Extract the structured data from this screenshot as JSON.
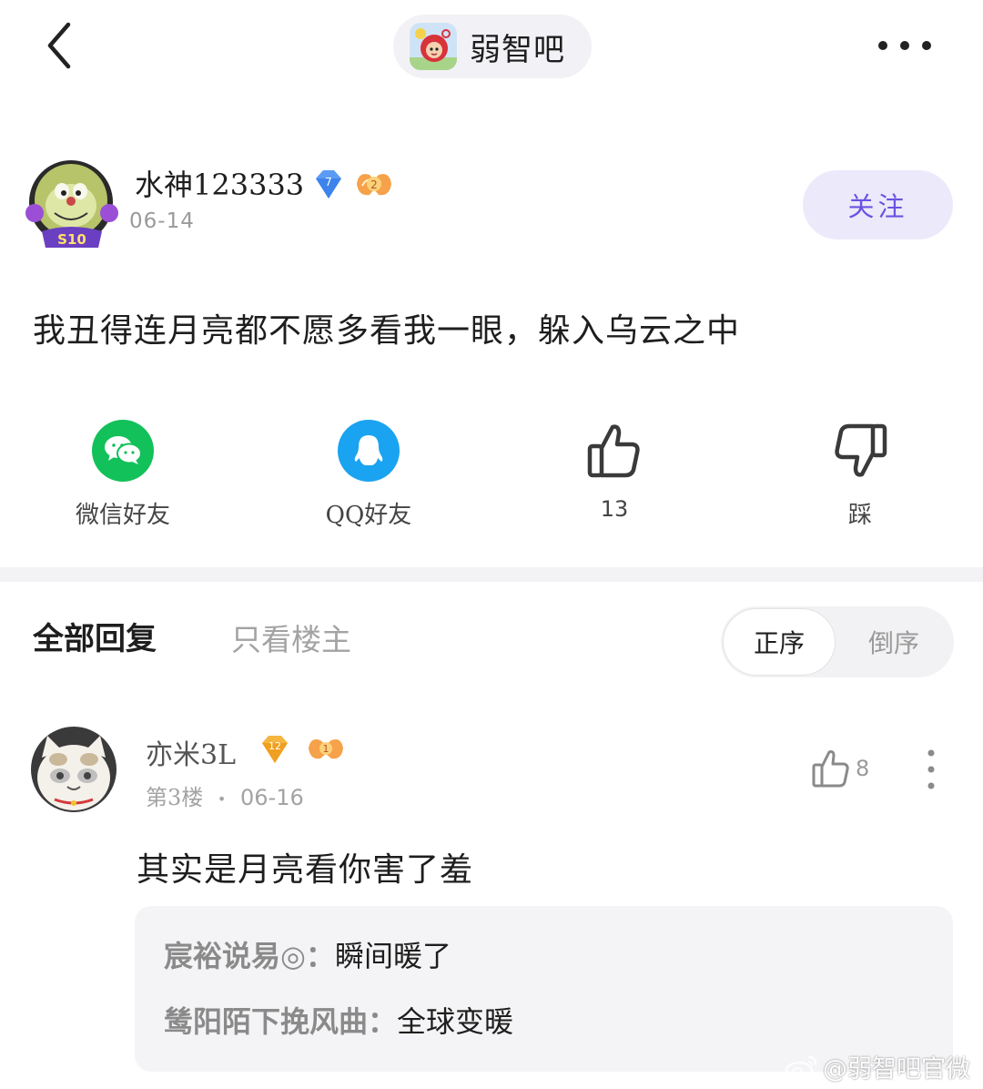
{
  "topbar": {
    "forum_name": "弱智吧"
  },
  "post": {
    "author": "水神123333",
    "level_badge": "7",
    "fan_badge": "2",
    "avatar_badge": "S10",
    "date": "06-14",
    "follow_label": "关注",
    "content": "我丑得连月亮都不愿多看我一眼，躲入乌云之中"
  },
  "actions": {
    "wechat_label": "微信好友",
    "qq_label": "QQ好友",
    "like_count": "13",
    "dislike_label": "踩"
  },
  "tabs": {
    "all_label": "全部回复",
    "op_only_label": "只看楼主",
    "sort_asc_label": "正序",
    "sort_desc_label": "倒序"
  },
  "reply": {
    "author": "亦米3L",
    "level_badge": "12",
    "fan_badge": "1",
    "floor": "第3楼",
    "separator": "•",
    "date": "06-16",
    "like_count": "8",
    "content": "其实是月亮看你害了羞",
    "sub_replies": [
      {
        "author": "宸裕说易◎：",
        "text": "瞬间暖了"
      },
      {
        "author": "鸶阳陌下挽风曲：",
        "text": "全球变暖"
      }
    ]
  },
  "watermark": "@弱智吧官微",
  "colors": {
    "accent": "#6b52e0",
    "follow_bg": "#ece9fb",
    "wechat": "#12c15a",
    "qq": "#1aa3f0",
    "muted": "#9a9a9a"
  }
}
